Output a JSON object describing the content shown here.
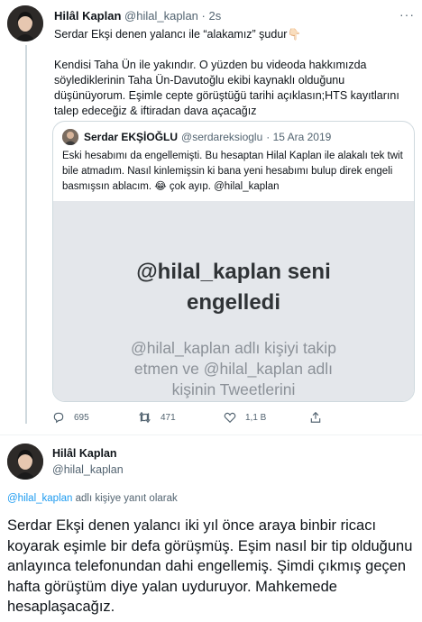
{
  "tweet1": {
    "author_name": "Hilâl Kaplan",
    "author_handle": "@hilal_kaplan",
    "time": "· 2s",
    "more_glyph": "···",
    "paragraphs": [
      "Serdar Ekşi denen yalancı ile “alakamız” şudur👇🏻",
      "Kendisi Taha Ün ile yakındır. O yüzden bu videoda hakkımızda söylediklerinin Taha Ün-Davutoğlu ekibi kaynaklı olduğunu düşünüyorum. Eşimle cepte görüştüğü tarihi açıklasın;HTS kayıtlarını talep edeceğiz & iftiradan dava açacağız"
    ],
    "quoted": {
      "author_name": "Serdar EKŞİOĞLU",
      "author_handle": "@serdareksioglu",
      "date": "· 15 Ara 2019",
      "text": "Eski hesabımı da engellemişti. Bu hesaptan Hilal Kaplan ile alakalı tek twit bile atmadım. Nasıl kinlemişsin ki bana yeni hesabımı bulup direk engeli basmışsın ablacım. 😂 çok ayıp. @hilal_kaplan",
      "media": {
        "headline_line1": "@hilal_kaplan seni",
        "headline_line2": "engelledi",
        "sub_line1": "@hilal_kaplan adlı kişiyi takip",
        "sub_line2": "etmen ve @hilal_kaplan adlı",
        "sub_line3": "kişinin Tweetlerini"
      }
    },
    "actions": {
      "replies": "695",
      "retweets": "471",
      "likes": "1,1 B"
    }
  },
  "tweet2": {
    "author_name": "Hilâl Kaplan",
    "author_handle": "@hilal_kaplan",
    "reply_mention": "@hilal_kaplan",
    "reply_suffix": " adlı kişiye yanıt olarak",
    "text": "Serdar Ekşi denen yalancı iki yıl önce araya binbir ricacı koyarak eşimle bir defa görüşmüş. Eşim nasıl bir tip olduğunu anlayınca telefonundan dahi  engellemiş. Şimdi çıkmış geçen hafta görüştüm diye yalan uyduruyor. Mahkemede hesaplaşacağız."
  },
  "colors": {
    "text": "#0f1419",
    "secondary": "#536471",
    "link": "#1d9bf0",
    "border": "#cfd9de",
    "media_bg": "#e4e7eb"
  },
  "icons": [
    "reply-icon",
    "retweet-icon",
    "like-icon",
    "share-icon",
    "more-icon"
  ]
}
